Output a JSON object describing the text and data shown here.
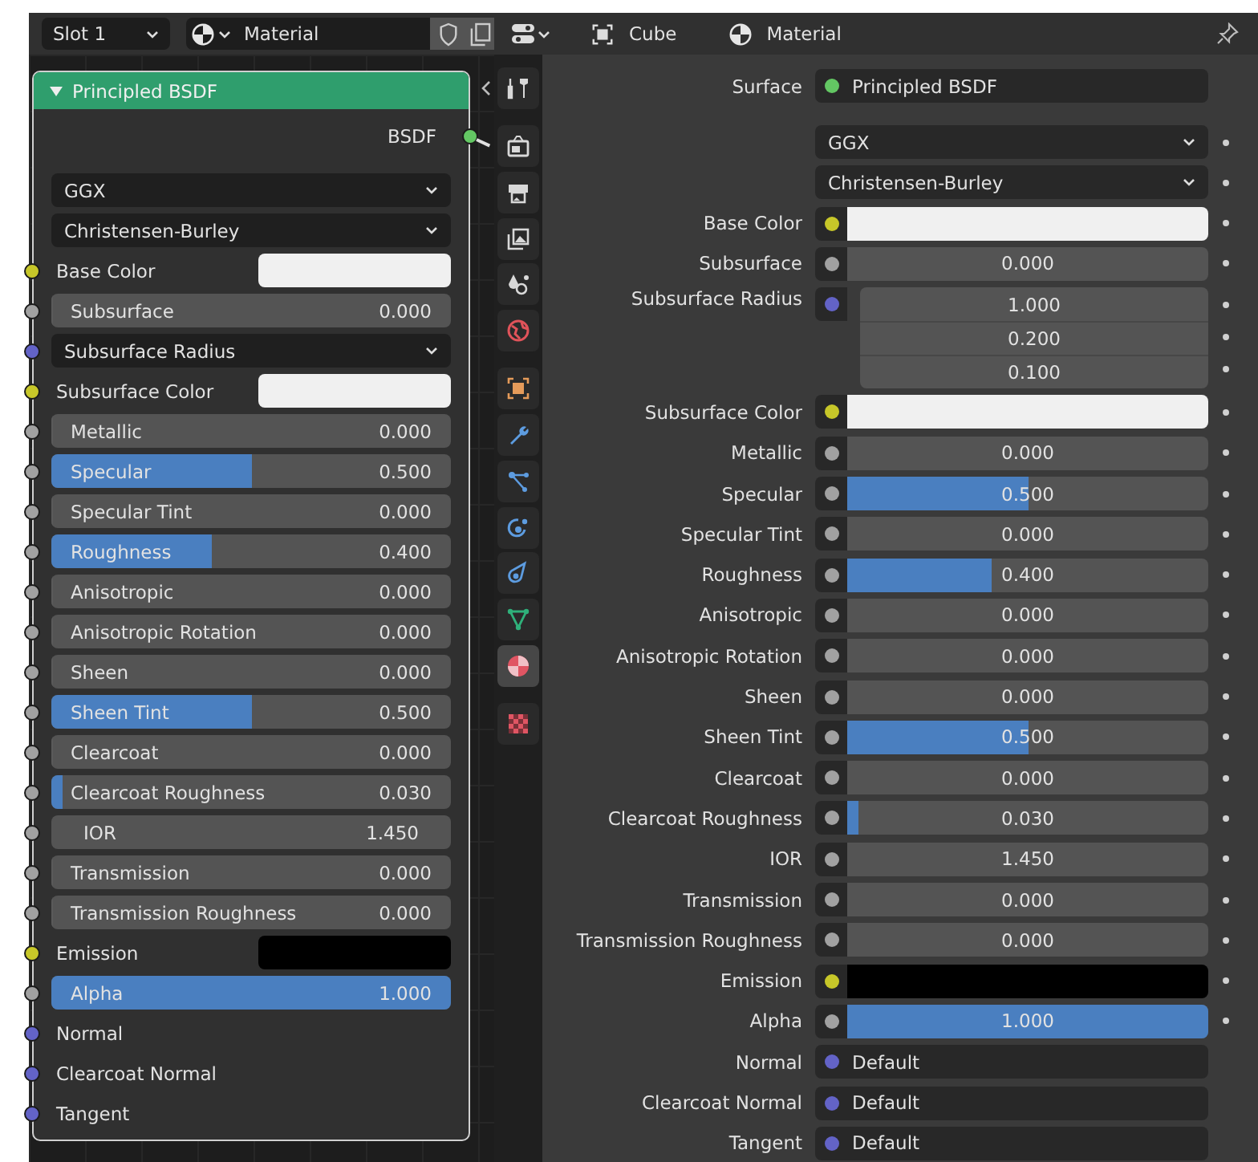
{
  "node_editor": {
    "header": {
      "slot": "Slot 1",
      "material": "Material"
    },
    "node": {
      "title": "Principled BSDF",
      "expanded": true,
      "output": {
        "label": "BSDF",
        "socket": {
          "color": "#63c763"
        }
      },
      "inputs": [
        {
          "kind": "dropdown",
          "value": "GGX"
        },
        {
          "kind": "dropdown",
          "value": "Christensen-Burley"
        },
        {
          "kind": "color",
          "label": "Base Color",
          "socket": {
            "color": "#c7c729"
          },
          "swatch": {
            "color": "#f0f0f0"
          }
        },
        {
          "kind": "slider",
          "label": "Subsurface",
          "value": "0.000",
          "level": 0,
          "socket": {
            "color": "#a1a1a1"
          }
        },
        {
          "kind": "dropdown",
          "value": "Subsurface Radius",
          "socket": {
            "color": "#6363c7"
          }
        },
        {
          "kind": "color",
          "label": "Subsurface Color",
          "socket": {
            "color": "#c7c729"
          },
          "swatch": {
            "color": "#f0f0f0"
          }
        },
        {
          "kind": "slider",
          "label": "Metallic",
          "value": "0.000",
          "level": 0,
          "socket": {
            "color": "#a1a1a1"
          }
        },
        {
          "kind": "slider",
          "label": "Specular",
          "value": "0.500",
          "level": 0.5,
          "socket": {
            "color": "#a1a1a1"
          }
        },
        {
          "kind": "slider",
          "label": "Specular Tint",
          "value": "0.000",
          "level": 0,
          "socket": {
            "color": "#a1a1a1"
          }
        },
        {
          "kind": "slider",
          "label": "Roughness",
          "value": "0.400",
          "level": 0.4,
          "socket": {
            "color": "#a1a1a1"
          }
        },
        {
          "kind": "slider",
          "label": "Anisotropic",
          "value": "0.000",
          "level": 0,
          "socket": {
            "color": "#a1a1a1"
          }
        },
        {
          "kind": "slider",
          "label": "Anisotropic Rotation",
          "value": "0.000",
          "level": 0,
          "socket": {
            "color": "#a1a1a1"
          }
        },
        {
          "kind": "slider",
          "label": "Sheen",
          "value": "0.000",
          "level": 0,
          "socket": {
            "color": "#a1a1a1"
          }
        },
        {
          "kind": "slider",
          "label": "Sheen Tint",
          "value": "0.500",
          "level": 0.5,
          "socket": {
            "color": "#a1a1a1"
          }
        },
        {
          "kind": "slider",
          "label": "Clearcoat",
          "value": "0.000",
          "level": 0,
          "socket": {
            "color": "#a1a1a1"
          }
        },
        {
          "kind": "slider",
          "label": "Clearcoat Roughness",
          "value": "0.030",
          "level": 0.03,
          "socket": {
            "color": "#a1a1a1"
          }
        },
        {
          "kind": "number",
          "label": "IOR",
          "value": "1.450",
          "socket": {
            "color": "#a1a1a1"
          }
        },
        {
          "kind": "slider",
          "label": "Transmission",
          "value": "0.000",
          "level": 0,
          "socket": {
            "color": "#a1a1a1"
          }
        },
        {
          "kind": "slider",
          "label": "Transmission Roughness",
          "value": "0.000",
          "level": 0,
          "socket": {
            "color": "#a1a1a1"
          }
        },
        {
          "kind": "color",
          "label": "Emission",
          "socket": {
            "color": "#c7c729"
          },
          "swatch": {
            "color": "#000000"
          }
        },
        {
          "kind": "slider",
          "label": "Alpha",
          "value": "1.000",
          "level": 1,
          "socket": {
            "color": "#a1a1a1"
          }
        },
        {
          "kind": "vector",
          "label": "Normal",
          "socket": {
            "color": "#6363c7"
          }
        },
        {
          "kind": "vector",
          "label": "Clearcoat Normal",
          "socket": {
            "color": "#6363c7"
          }
        },
        {
          "kind": "vector",
          "label": "Tangent",
          "socket": {
            "color": "#6363c7"
          }
        }
      ]
    }
  },
  "properties": {
    "header": {
      "object": "Cube",
      "material": "Material"
    },
    "tab_groups": [
      {
        "tabs": [
          {
            "kind": "tool",
            "selected": false
          }
        ]
      },
      {
        "tabs": [
          {
            "kind": "render",
            "selected": false
          },
          {
            "kind": "output",
            "selected": false
          },
          {
            "kind": "view-layer",
            "selected": false
          },
          {
            "kind": "scene",
            "selected": false
          },
          {
            "kind": "world",
            "selected": false
          }
        ]
      },
      {
        "tabs": [
          {
            "kind": "object",
            "selected": false
          },
          {
            "kind": "modifier",
            "selected": false
          },
          {
            "kind": "particles",
            "selected": false
          },
          {
            "kind": "physics",
            "selected": false
          },
          {
            "kind": "constraints",
            "selected": false
          },
          {
            "kind": "data",
            "selected": false
          },
          {
            "kind": "material",
            "selected": true
          }
        ]
      },
      {
        "tabs": [
          {
            "kind": "texture",
            "selected": false
          }
        ]
      }
    ],
    "surface": {
      "label": "Surface",
      "value": "Principled BSDF",
      "socket": {
        "color": "#63c763"
      }
    },
    "rows": [
      {
        "kind": "dropdown",
        "value": "GGX"
      },
      {
        "kind": "dropdown",
        "value": "Christensen-Burley"
      },
      {
        "kind": "color",
        "label": "Base Color",
        "socket": {
          "color": "#c7c729"
        },
        "swatch": {
          "color": "#f0f0f0"
        }
      },
      {
        "kind": "slider",
        "label": "Subsurface",
        "value": "0.000",
        "level": 0,
        "socket": {
          "color": "#a1a1a1"
        }
      },
      {
        "kind": "vector",
        "label": "Subsurface Radius",
        "socket": {
          "color": "#6363c7"
        },
        "values": [
          "1.000",
          "0.200",
          "0.100"
        ]
      },
      {
        "kind": "color",
        "label": "Subsurface Color",
        "socket": {
          "color": "#c7c729"
        },
        "swatch": {
          "color": "#f0f0f0"
        }
      },
      {
        "kind": "slider",
        "label": "Metallic",
        "value": "0.000",
        "level": 0,
        "socket": {
          "color": "#a1a1a1"
        }
      },
      {
        "kind": "slider",
        "label": "Specular",
        "value": "0.500",
        "level": 0.5,
        "socket": {
          "color": "#a1a1a1"
        }
      },
      {
        "kind": "slider",
        "label": "Specular Tint",
        "value": "0.000",
        "level": 0,
        "socket": {
          "color": "#a1a1a1"
        }
      },
      {
        "kind": "slider",
        "label": "Roughness",
        "value": "0.400",
        "level": 0.4,
        "socket": {
          "color": "#a1a1a1"
        }
      },
      {
        "kind": "slider",
        "label": "Anisotropic",
        "value": "0.000",
        "level": 0,
        "socket": {
          "color": "#a1a1a1"
        }
      },
      {
        "kind": "slider",
        "label": "Anisotropic Rotation",
        "value": "0.000",
        "level": 0,
        "socket": {
          "color": "#a1a1a1"
        }
      },
      {
        "kind": "slider",
        "label": "Sheen",
        "value": "0.000",
        "level": 0,
        "socket": {
          "color": "#a1a1a1"
        }
      },
      {
        "kind": "slider",
        "label": "Sheen Tint",
        "value": "0.500",
        "level": 0.5,
        "socket": {
          "color": "#a1a1a1"
        }
      },
      {
        "kind": "slider",
        "label": "Clearcoat",
        "value": "0.000",
        "level": 0,
        "socket": {
          "color": "#a1a1a1"
        }
      },
      {
        "kind": "slider",
        "label": "Clearcoat Roughness",
        "value": "0.030",
        "level": 0.03,
        "socket": {
          "color": "#a1a1a1"
        }
      },
      {
        "kind": "number",
        "label": "IOR",
        "value": "1.450",
        "socket": {
          "color": "#a1a1a1"
        }
      },
      {
        "kind": "slider",
        "label": "Transmission",
        "value": "0.000",
        "level": 0,
        "socket": {
          "color": "#a1a1a1"
        }
      },
      {
        "kind": "slider",
        "label": "Transmission Roughness",
        "value": "0.000",
        "level": 0,
        "socket": {
          "color": "#a1a1a1"
        }
      },
      {
        "kind": "color",
        "label": "Emission",
        "socket": {
          "color": "#c7c729"
        },
        "swatch": {
          "color": "#000000"
        }
      },
      {
        "kind": "slider",
        "label": "Alpha",
        "value": "1.000",
        "level": 1,
        "socket": {
          "color": "#a1a1a1"
        }
      },
      {
        "kind": "link",
        "label": "Normal",
        "value": "Default",
        "socket": {
          "color": "#6363c7"
        }
      },
      {
        "kind": "link",
        "label": "Clearcoat Normal",
        "value": "Default",
        "socket": {
          "color": "#6363c7"
        }
      },
      {
        "kind": "link",
        "label": "Tangent",
        "value": "Default",
        "socket": {
          "color": "#6363c7"
        }
      }
    ]
  }
}
